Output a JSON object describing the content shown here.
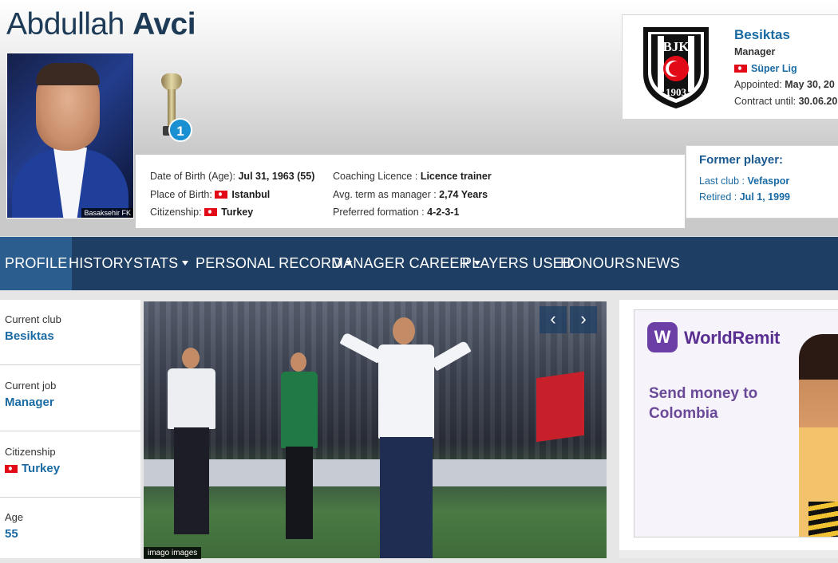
{
  "header": {
    "first_name": "Abdullah",
    "last_name": "Avci",
    "photo_caption": "Basaksehir FK",
    "trophy_count": "1"
  },
  "info": {
    "dob_label": "Date of Birth (Age):",
    "dob_value": "Jul 31, 1963 (55)",
    "pob_label": "Place of Birth:",
    "pob_value": "Istanbul",
    "citizenship_label": "Citizenship:",
    "citizenship_value": "Turkey",
    "licence_label": "Coaching Licence :",
    "licence_value": "Licence trainer",
    "term_label": "Avg. term as manager :",
    "term_value": "2,74 Years",
    "formation_label": "Preferred formation :",
    "formation_value": "4-2-3-1"
  },
  "club": {
    "name": "Besiktas",
    "role": "Manager",
    "league": "Süper Lig",
    "appointed_label": "Appointed:",
    "appointed_value": "May 30, 20",
    "contract_label": "Contract until:",
    "contract_value": "30.06.20",
    "crest_text": "BJK",
    "crest_year": "1903"
  },
  "former": {
    "title": "Former player:",
    "last_club_label": "Last club :",
    "last_club_value": "Vefaspor",
    "retired_label": "Retired :",
    "retired_value": "Jul 1, 1999"
  },
  "nav": {
    "items": [
      "PROFILE",
      "HISTORY",
      "STATS",
      "PERSONAL RECORD",
      "MANAGER CAREER",
      "PLAYERS USED",
      "HONOURS",
      "NEWS"
    ]
  },
  "sidebar": {
    "items": [
      {
        "label": "Current club",
        "value": "Besiktas"
      },
      {
        "label": "Current job",
        "value": "Manager"
      },
      {
        "label": "Citizenship",
        "value": "Turkey"
      },
      {
        "label": "Age",
        "value": "55"
      }
    ]
  },
  "gallery": {
    "prev_icon": "chevron-left-icon",
    "next_icon": "chevron-right-icon",
    "credit": "imago images"
  },
  "ad": {
    "logo_letter": "W",
    "brand": "WorldRemit",
    "text": "Send money to Colombia"
  },
  "colors": {
    "nav_bg": "#1e3e64",
    "nav_active": "#2c5d8f",
    "link": "#1a6aa3",
    "brand_purple": "#6b3fa5"
  }
}
